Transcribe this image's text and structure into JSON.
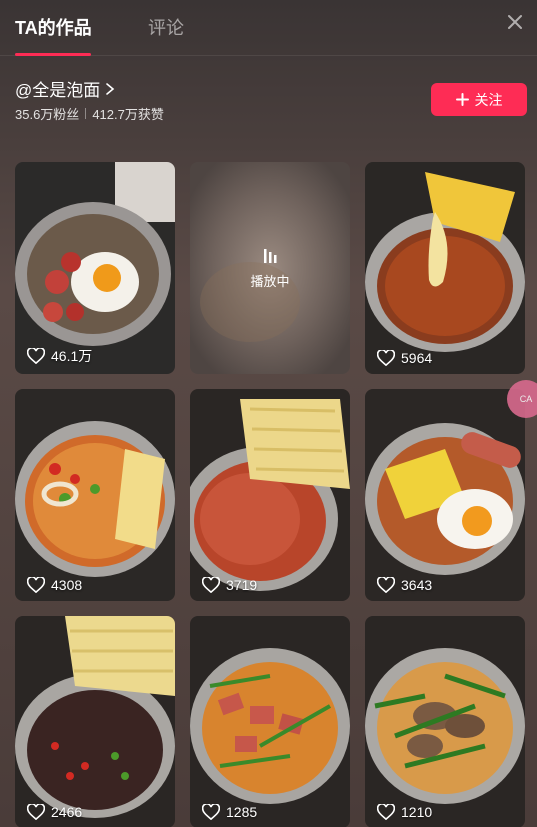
{
  "tabs": {
    "active": "TA的作品",
    "inactive": "评论"
  },
  "profile": {
    "name": "@全是泡面",
    "followers": "35.6万粉丝",
    "likes": "412.7万获赞"
  },
  "follow_button": {
    "label": "关注"
  },
  "playing_label": "播放中",
  "side_badge": "CA",
  "videos": [
    {
      "likes": "46.1万"
    },
    {
      "likes": ""
    },
    {
      "likes": "5964"
    },
    {
      "likes": "4308"
    },
    {
      "likes": "3719"
    },
    {
      "likes": "3643"
    },
    {
      "likes": "2466"
    },
    {
      "likes": "1285"
    },
    {
      "likes": "1210"
    }
  ]
}
